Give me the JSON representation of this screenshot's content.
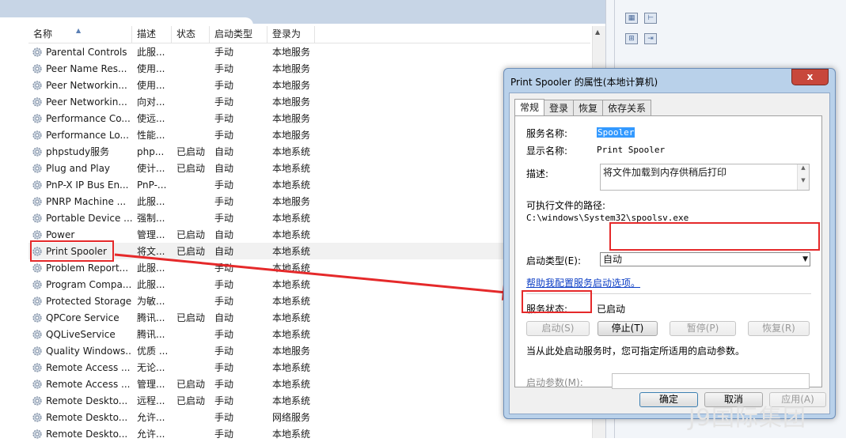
{
  "columns": {
    "name": "名称",
    "desc": "描述",
    "status": "状态",
    "startup": "启动类型",
    "logon": "登录为"
  },
  "services": [
    {
      "name": "Parental Controls",
      "desc": "此服...",
      "status": "",
      "startup": "手动",
      "logon": "本地服务"
    },
    {
      "name": "Peer Name Res...",
      "desc": "使用...",
      "status": "",
      "startup": "手动",
      "logon": "本地服务"
    },
    {
      "name": "Peer Networkin...",
      "desc": "使用...",
      "status": "",
      "startup": "手动",
      "logon": "本地服务"
    },
    {
      "name": "Peer Networkin...",
      "desc": "向对...",
      "status": "",
      "startup": "手动",
      "logon": "本地服务"
    },
    {
      "name": "Performance Co...",
      "desc": "使远...",
      "status": "",
      "startup": "手动",
      "logon": "本地服务"
    },
    {
      "name": "Performance Lo...",
      "desc": "性能...",
      "status": "",
      "startup": "手动",
      "logon": "本地服务"
    },
    {
      "name": "phpstudy服务",
      "desc": "php...",
      "status": "已启动",
      "startup": "自动",
      "logon": "本地系统"
    },
    {
      "name": "Plug and Play",
      "desc": "使计...",
      "status": "已启动",
      "startup": "自动",
      "logon": "本地系统"
    },
    {
      "name": "PnP-X IP Bus En...",
      "desc": "PnP-...",
      "status": "",
      "startup": "手动",
      "logon": "本地系统"
    },
    {
      "name": "PNRP Machine ...",
      "desc": "此服...",
      "status": "",
      "startup": "手动",
      "logon": "本地服务"
    },
    {
      "name": "Portable Device ...",
      "desc": "强制...",
      "status": "",
      "startup": "手动",
      "logon": "本地系统"
    },
    {
      "name": "Power",
      "desc": "管理...",
      "status": "已启动",
      "startup": "自动",
      "logon": "本地系统"
    },
    {
      "name": "Print Spooler",
      "desc": "将文...",
      "status": "已启动",
      "startup": "自动",
      "logon": "本地系统"
    },
    {
      "name": "Problem Report...",
      "desc": "此服...",
      "status": "",
      "startup": "手动",
      "logon": "本地系统"
    },
    {
      "name": "Program Compa...",
      "desc": "此服...",
      "status": "",
      "startup": "手动",
      "logon": "本地系统"
    },
    {
      "name": "Protected Storage",
      "desc": "为敏...",
      "status": "",
      "startup": "手动",
      "logon": "本地系统"
    },
    {
      "name": "QPCore Service",
      "desc": "腾讯...",
      "status": "已启动",
      "startup": "自动",
      "logon": "本地系统"
    },
    {
      "name": "QQLiveService",
      "desc": "腾讯...",
      "status": "",
      "startup": "手动",
      "logon": "本地系统"
    },
    {
      "name": "Quality Windows...",
      "desc": "优质 ...",
      "status": "",
      "startup": "手动",
      "logon": "本地服务"
    },
    {
      "name": "Remote Access ...",
      "desc": "无论...",
      "status": "",
      "startup": "手动",
      "logon": "本地系统"
    },
    {
      "name": "Remote Access ...",
      "desc": "管理...",
      "status": "已启动",
      "startup": "手动",
      "logon": "本地系统"
    },
    {
      "name": "Remote Deskto...",
      "desc": "远程...",
      "status": "已启动",
      "startup": "手动",
      "logon": "本地系统"
    },
    {
      "name": "Remote Deskto...",
      "desc": "允许...",
      "status": "",
      "startup": "手动",
      "logon": "网络服务"
    },
    {
      "name": "Remote Deskto...",
      "desc": "允许...",
      "status": "",
      "startup": "手动",
      "logon": "本地系统"
    }
  ],
  "dialog": {
    "title": "Print Spooler 的属性(本地计算机)",
    "close": "x",
    "tabs": [
      "常规",
      "登录",
      "恢复",
      "依存关系"
    ],
    "service_name_label": "服务名称:",
    "service_name": "Spooler",
    "display_name_label": "显示名称:",
    "display_name": "Print Spooler",
    "description_label": "描述:",
    "description": "将文件加载到内存供稍后打印",
    "path_label": "可执行文件的路径:",
    "path": "C:\\windows\\System32\\spoolsv.exe",
    "startup_type_label": "启动类型(E):",
    "startup_type": "自动",
    "help_link": "帮助我配置服务启动选项。",
    "status_label": "服务状态:",
    "status_value": "已启动",
    "btn_start": "启动(S)",
    "btn_stop": "停止(T)",
    "btn_pause": "暂停(P)",
    "btn_resume": "恢复(R)",
    "hint": "当从此处启动服务时，您可指定所适用的启动参数。",
    "param_label": "启动参数(M):",
    "param_value": "",
    "btn_ok": "确定",
    "btn_cancel": "取消",
    "btn_apply": "应用(A)"
  },
  "watermark": "J9国际集团",
  "colors": {
    "highlight_red": "#e5292a",
    "link_blue": "#0c3ec5",
    "selection_blue": "#3399ff"
  }
}
